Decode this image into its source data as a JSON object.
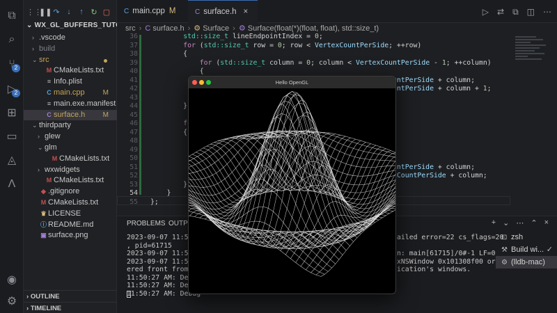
{
  "sidebar": {
    "title": "WX_GL_BUFFERS_TUTORIAL",
    "items": [
      {
        "label": ".vscode",
        "kind": "folder-closed",
        "indent": 1
      },
      {
        "label": "build",
        "kind": "folder-closed",
        "indent": 1,
        "dim": true
      },
      {
        "label": "src",
        "kind": "folder-open",
        "indent": 1,
        "modified_dot": true,
        "color": "#c5a55a"
      },
      {
        "label": "CMakeLists.txt",
        "kind": "file",
        "indent": 2,
        "icon": "M",
        "icon_color": "#c25050"
      },
      {
        "label": "Info.plist",
        "kind": "file",
        "indent": 2,
        "icon": "≡",
        "icon_color": "#bbbbbb"
      },
      {
        "label": "main.cpp",
        "kind": "file",
        "indent": 2,
        "icon": "C",
        "icon_color": "#5aa0e0",
        "mark": "M",
        "color": "#c5a55a"
      },
      {
        "label": "main.exe.manifest",
        "kind": "file",
        "indent": 2,
        "icon": "≡",
        "icon_color": "#bbbbbb"
      },
      {
        "label": "surface.h",
        "kind": "file",
        "indent": 2,
        "icon": "C",
        "icon_color": "#a17fd6",
        "mark": "M",
        "color": "#c5a55a",
        "selected": true
      },
      {
        "label": "thirdparty",
        "kind": "folder-open",
        "indent": 1
      },
      {
        "label": "glew",
        "kind": "folder-closed",
        "indent": 2
      },
      {
        "label": "glm",
        "kind": "folder-open",
        "indent": 2
      },
      {
        "label": "CMakeLists.txt",
        "kind": "file",
        "indent": 3,
        "icon": "M",
        "icon_color": "#c25050"
      },
      {
        "label": "wxwidgets",
        "kind": "folder-closed",
        "indent": 2
      },
      {
        "label": "CMakeLists.txt",
        "kind": "file",
        "indent": 2,
        "icon": "M",
        "icon_color": "#c25050"
      },
      {
        "label": ".gitignore",
        "kind": "file",
        "indent": 1,
        "icon": "◆",
        "icon_color": "#c25050"
      },
      {
        "label": "CMakeLists.txt",
        "kind": "file",
        "indent": 1,
        "icon": "M",
        "icon_color": "#c25050"
      },
      {
        "label": "LICENSE",
        "kind": "file",
        "indent": 1,
        "icon": "♛",
        "icon_color": "#d7ba7d"
      },
      {
        "label": "README.md",
        "kind": "file",
        "indent": 1,
        "icon": "ⓘ",
        "icon_color": "#5aa0e0"
      },
      {
        "label": "surface.png",
        "kind": "file",
        "indent": 1,
        "icon": "▣",
        "icon_color": "#a17fd6"
      }
    ],
    "outline_label": "OUTLINE",
    "timeline_label": "TIMELINE"
  },
  "activity_badges": [
    "2",
    "2"
  ],
  "tabs": [
    {
      "label": "main.cpp",
      "mark": "M",
      "active": false
    },
    {
      "label": "surface.h",
      "mark": "M",
      "active": true,
      "close": "×"
    }
  ],
  "breadcrumb": [
    "src",
    "surface.h",
    "Surface",
    "Surface(float(*)(float, float), std::size_t)"
  ],
  "breadcrumb_icons": {
    "file": "C",
    "class": "⚙",
    "method": "⚙"
  },
  "code": [
    {
      "n": "36",
      "text": "        std::size_t lineEndpointIndex = 0;"
    },
    {
      "n": "37",
      "text": "        for (std::size_t row = 0; row < VertexCountPerSide; ++row)"
    },
    {
      "n": "38",
      "text": "        {"
    },
    {
      "n": "39",
      "text": "            for (std::size_t column = 0; column < VertexCountPerSide - 1; ++column)"
    },
    {
      "n": "40",
      "text": "            {"
    },
    {
      "n": "41",
      "text": "                                                   VertexCountPerSide + column;"
    },
    {
      "n": "42",
      "text": "                                                   VertexCountPerSide + column + 1;"
    },
    {
      "n": "43",
      "text": ""
    },
    {
      "n": "44",
      "text": "        }"
    },
    {
      "n": "45",
      "text": ""
    },
    {
      "n": "46",
      "text": "        for                                               w)"
    },
    {
      "n": "47",
      "text": "        {"
    },
    {
      "n": "48",
      "text": ""
    },
    {
      "n": "49",
      "text": "                                                 ++column)"
    },
    {
      "n": "50",
      "text": ""
    },
    {
      "n": "51",
      "text": "                                                   VertexCountPerSide + column;"
    },
    {
      "n": "52",
      "text": "                                                    = VertexCountPerSide + column;"
    },
    {
      "n": "53",
      "text": "        }"
    },
    {
      "n": "54",
      "text": "    }"
    },
    {
      "n": "55",
      "text": "};"
    }
  ],
  "current_line": "54",
  "panel": {
    "tabs": [
      "PROBLEMS",
      "OUTPUT"
    ],
    "terminal_left": [
      "2023-09-07 11:50:2",
      ", pid=61715",
      "2023-09-07 11:50:2",
      "2023-09-07 11:50:2",
      "ered front from a",
      "11:50:27 AM: Debug",
      "11:50:27 AM: Debug",
      "11:50:27 AM: Debug"
    ],
    "terminal_right": [
      "ailed error=22 cs_flags=20",
      "",
      "n: main[61715]/0#-1 LF=0",
      "xNSWindow 0x101308f00 ord",
      "ication's windows.",
      "",
      "",
      ""
    ],
    "tools": [
      "+",
      "⌄",
      "⋯",
      "⌃",
      "×"
    ],
    "processes": [
      {
        "label": "zsh",
        "icon": "⊡"
      },
      {
        "label": "Build wi...",
        "icon": "⚒",
        "check": "✓"
      },
      {
        "label": "(lldb-mac)",
        "icon": "⚙",
        "selected": true
      }
    ]
  },
  "glwindow": {
    "title": "Hello OpenGL",
    "buttons": [
      "#ff5f57",
      "#febc2e",
      "#28c840"
    ]
  },
  "colors": {
    "accent": "#3b6fb8",
    "modified": "#c5a55a"
  }
}
